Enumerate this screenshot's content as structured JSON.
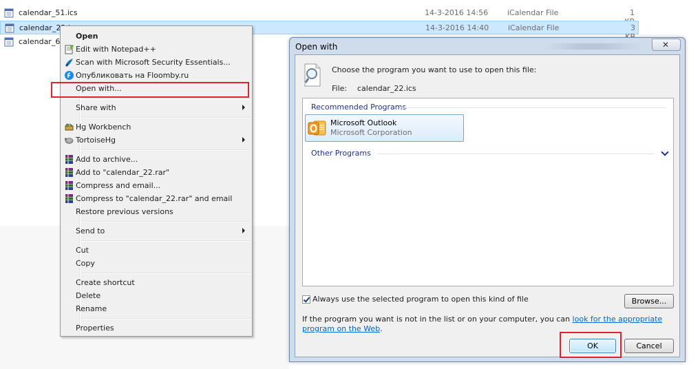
{
  "files": [
    {
      "name": "calendar_51.ics",
      "date": "14-3-2016 14:56",
      "type": "iCalendar File",
      "size": "1 KB"
    },
    {
      "name": "calendar_22.ics",
      "date": "14-3-2016 14:40",
      "type": "iCalendar File",
      "size": "3 KB"
    },
    {
      "name": "calendar_6..."
    }
  ],
  "context_menu": {
    "items": [
      {
        "label": "Open"
      },
      {
        "label": "Edit with Notepad++"
      },
      {
        "label": "Scan with Microsoft Security Essentials..."
      },
      {
        "label": "Опубликовать на Floomby.ru"
      },
      {
        "label": "Open with..."
      },
      {
        "label": "Share with"
      },
      {
        "label": "Hg Workbench"
      },
      {
        "label": "TortoiseHg"
      },
      {
        "label": "Add to archive..."
      },
      {
        "label": "Add to \"calendar_22.rar\""
      },
      {
        "label": "Compress and email..."
      },
      {
        "label": "Compress to \"calendar_22.rar\" and email"
      },
      {
        "label": "Restore previous versions"
      },
      {
        "label": "Send to"
      },
      {
        "label": "Cut"
      },
      {
        "label": "Copy"
      },
      {
        "label": "Create shortcut"
      },
      {
        "label": "Delete"
      },
      {
        "label": "Rename"
      },
      {
        "label": "Properties"
      }
    ]
  },
  "dialog": {
    "title": "Open with",
    "close_glyph": "✕",
    "choose_text": "Choose the program you want to use to open this file:",
    "file_label": "File:",
    "file_value": "calendar_22.ics",
    "recommended_header": "Recommended Programs",
    "other_header": "Other Programs",
    "program": {
      "name": "Microsoft Outlook",
      "company": "Microsoft Corporation"
    },
    "always_use_label": "Always use the selected program to open this kind of file",
    "browse_label": "Browse...",
    "info_prefix": "If the program you want is not in the list or on your computer, you can ",
    "info_link": "look for the appropriate program on the Web",
    "info_suffix": ".",
    "ok_label": "OK",
    "cancel_label": "Cancel"
  },
  "colors": {
    "highlight_red": "#e0212e",
    "selection": "#cce8ff",
    "link": "#0066cc"
  }
}
